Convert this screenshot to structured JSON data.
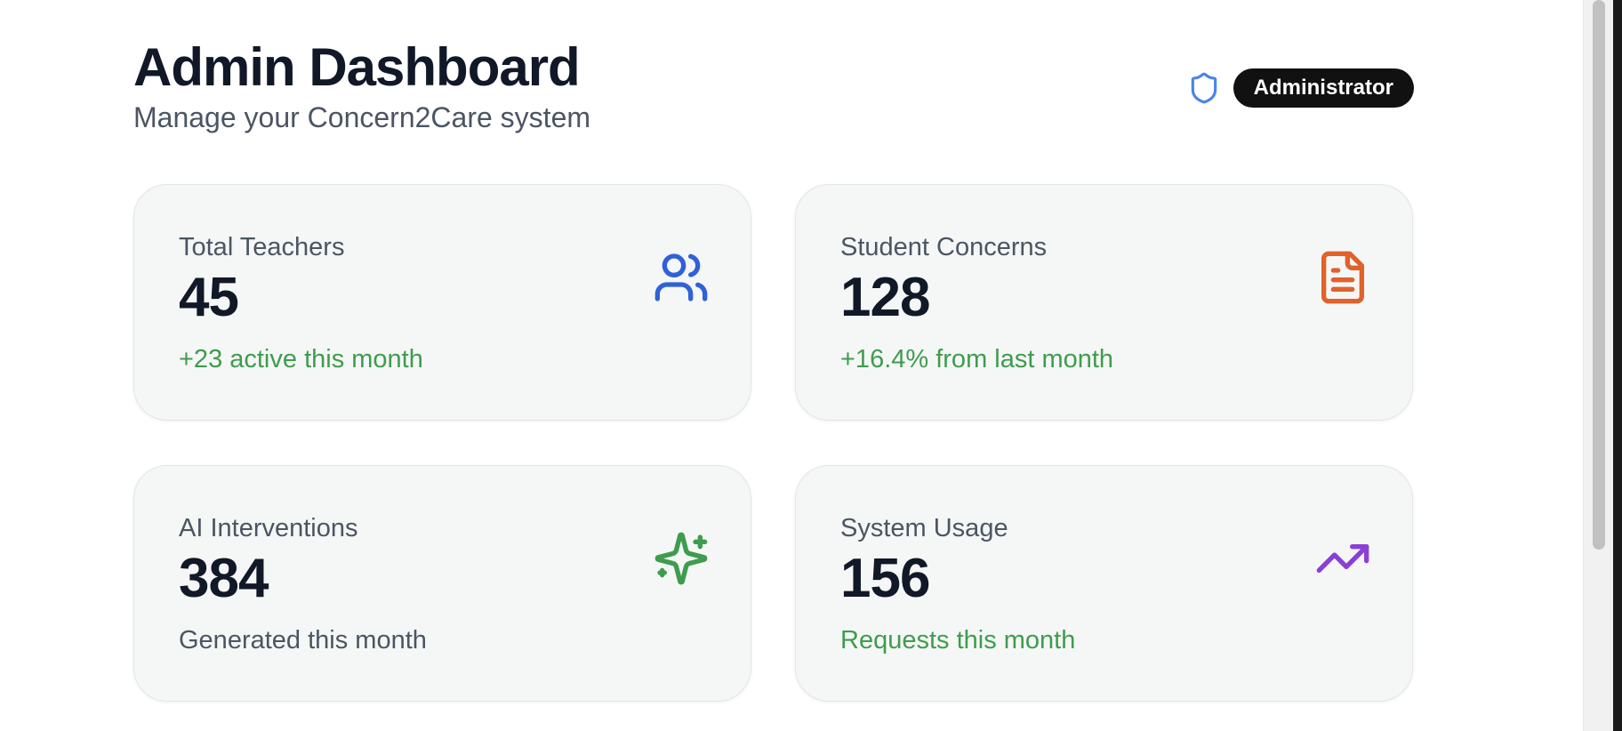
{
  "header": {
    "title": "Admin Dashboard",
    "subtitle": "Manage your Concern2Care system",
    "role_badge": "Administrator",
    "role_icon": "shield-icon"
  },
  "stats": [
    {
      "label": "Total Teachers",
      "value": "45",
      "note": "+23 active this month",
      "note_color": "#3f9c4e",
      "icon": "users-icon",
      "icon_color": "#2f62d8"
    },
    {
      "label": "Student Concerns",
      "value": "128",
      "note": "+16.4% from last month",
      "note_color": "#3f9c4e",
      "icon": "file-text-icon",
      "icon_color": "#e0622a"
    },
    {
      "label": "AI Interventions",
      "value": "384",
      "note": "Generated this month",
      "note_color": "#4b5563",
      "icon": "sparkles-icon",
      "icon_color": "#3f9c4e"
    },
    {
      "label": "System Usage",
      "value": "156",
      "note": "Requests this month",
      "note_color": "#3f9c4e",
      "icon": "trending-up-icon",
      "icon_color": "#8b3fd6"
    }
  ],
  "colors": {
    "shield": "#4a86e8",
    "badge_bg": "#111111",
    "card_bg": "#f5f7f6"
  }
}
